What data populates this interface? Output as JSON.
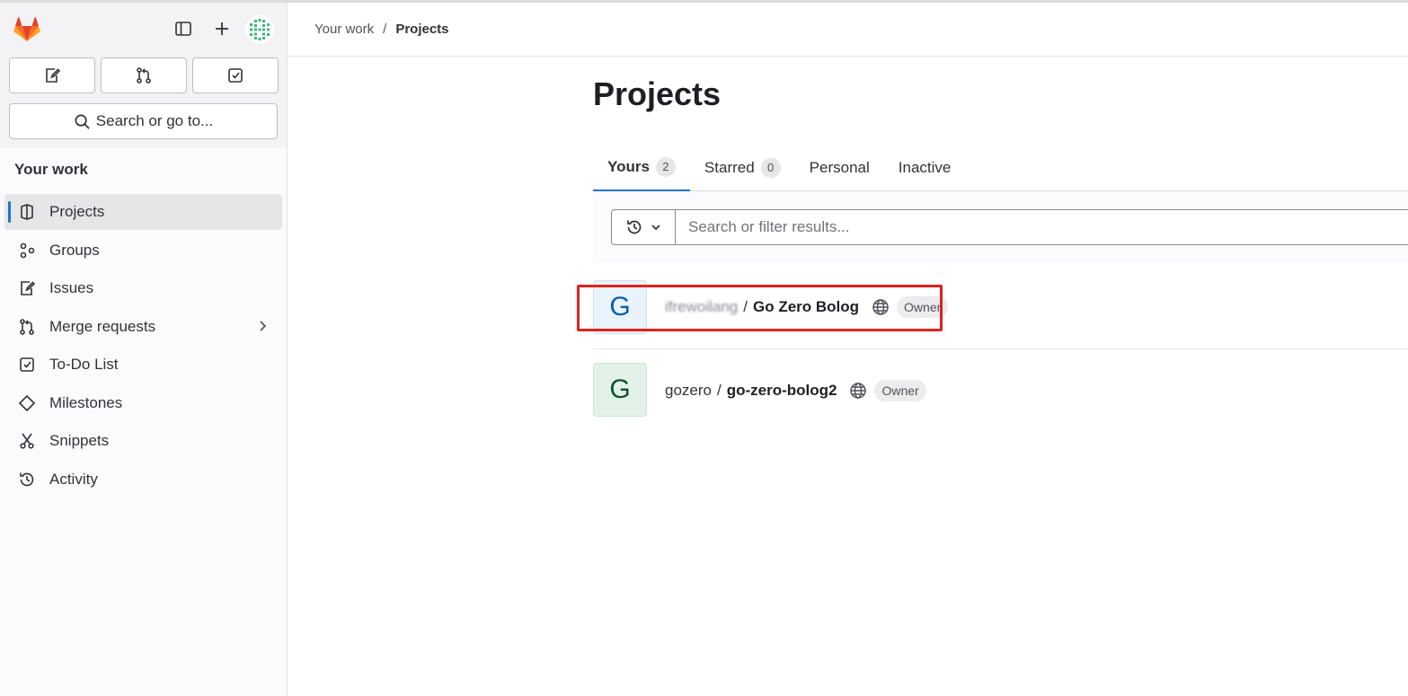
{
  "sidebar": {
    "search_label": "Search or go to...",
    "section_title": "Your work",
    "items": [
      {
        "label": "Projects",
        "icon": "project-icon",
        "active": true
      },
      {
        "label": "Groups",
        "icon": "group-icon"
      },
      {
        "label": "Issues",
        "icon": "issues-icon"
      },
      {
        "label": "Merge requests",
        "icon": "merge-request-icon"
      },
      {
        "label": "To-Do List",
        "icon": "todo-icon"
      },
      {
        "label": "Milestones",
        "icon": "milestone-icon"
      },
      {
        "label": "Snippets",
        "icon": "snippet-icon"
      },
      {
        "label": "Activity",
        "icon": "history-icon"
      }
    ]
  },
  "breadcrumb": {
    "parent": "Your work",
    "separator": "/",
    "current": "Projects"
  },
  "page": {
    "title": "Projects"
  },
  "tabs": [
    {
      "label": "Yours",
      "count": "2",
      "active": true
    },
    {
      "label": "Starred",
      "count": "0"
    },
    {
      "label": "Personal"
    },
    {
      "label": "Inactive"
    }
  ],
  "filter": {
    "placeholder": "Search or filter results..."
  },
  "projects": [
    {
      "avatar_letter": "G",
      "namespace": "ifrewoilang",
      "separator": "/",
      "name": "Go Zero Bolog",
      "role": "Owner"
    },
    {
      "avatar_letter": "G",
      "namespace": "gozero",
      "separator": "/",
      "name": "go-zero-bolog2",
      "role": "Owner"
    }
  ],
  "colors": {
    "accent": "#1f75cb",
    "highlight_box": "#e0211c",
    "logo_orange": "#e24329"
  }
}
